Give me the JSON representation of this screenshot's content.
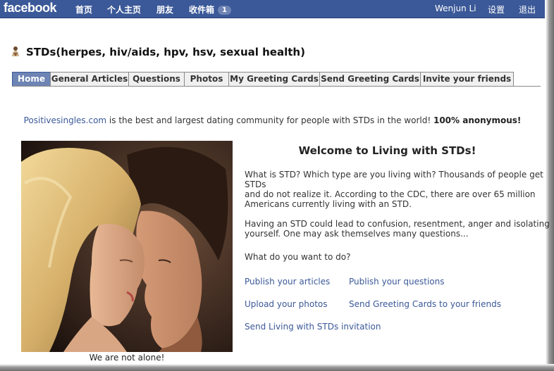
{
  "topbar": {
    "logo": "facebook",
    "nav": [
      "首页",
      "个人主页",
      "朋友",
      "收件箱"
    ],
    "inbox_count": "1",
    "user_name": "Wenjun Li",
    "settings": "设置",
    "logout": "退出"
  },
  "app": {
    "title": "STDs(herpes, hiv/aids, hpv, hsv, sexual health)"
  },
  "tabs": [
    "Home",
    "General Articles",
    "Questions",
    "Photos",
    "My Greeting Cards",
    "Send Greeting Cards",
    "Invite your friends"
  ],
  "active_tab": "Home",
  "promo": {
    "link": "Positivesingles.com",
    "text": " is the best and largest dating community for people with STDs in the world! ",
    "bold": "100% anonymous!"
  },
  "photo": {
    "caption": "We are not alone!"
  },
  "welcome": {
    "heading": "Welcome to Living with STDs!",
    "para1_line1": "What is STD? Which type are you living with? Thousands of people get",
    "para1_line2": "STDs",
    "para1_line3": "and do not realize it. According to the CDC, there are over 65 million",
    "para1_line4": "Americans currently living with an STD.",
    "para2_line1": "Having an STD could lead to confusion, resentment, anger and isolating",
    "para2_line2": "yourself. One may ask themselves many questions...",
    "question": "What do you want to do?"
  },
  "actions": {
    "publish_articles": "Publish your articles",
    "publish_questions": "Publish your questions",
    "upload_photos": "Upload your photos",
    "send_cards": "Send Greeting Cards to your friends",
    "send_invitation": "Send Living with STDs invitation"
  },
  "colors": {
    "brand": "#3b5998",
    "active_tab": "#6d84b4",
    "link": "#3b5998"
  }
}
